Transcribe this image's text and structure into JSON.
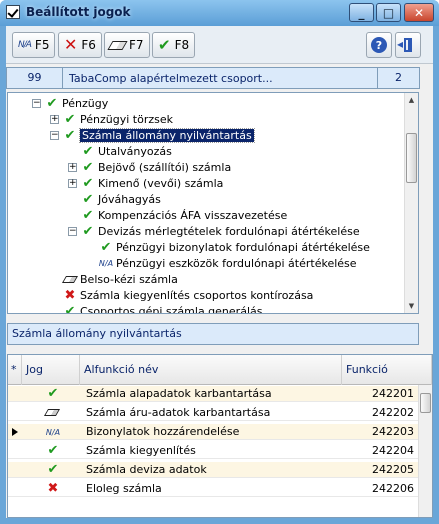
{
  "window": {
    "title": "Beállított jogok"
  },
  "toolbar": {
    "f5_label": "F5",
    "f6_label": "F6",
    "f7_label": "F7",
    "f8_label": "F8",
    "na_glyph": "N/A",
    "help_glyph": "?"
  },
  "group": {
    "id": "99",
    "name": "TabaComp alapértelmezett csoport...",
    "count": "2"
  },
  "tree": {
    "items": [
      {
        "label": "Pénzügy",
        "icon": "check",
        "expander": "minus"
      },
      {
        "label": "Pénzügyi törzsek",
        "icon": "check",
        "expander": "plus"
      },
      {
        "label": "Számla állomány nyilvántartás",
        "icon": "check",
        "expander": "minus",
        "selected": true
      },
      {
        "label": "Utalványozás",
        "icon": "check"
      },
      {
        "label": "Bejövő (szállítói) számla",
        "icon": "check",
        "expander": "plus"
      },
      {
        "label": "Kimenő (vevői) számla",
        "icon": "check",
        "expander": "plus"
      },
      {
        "label": "Jóváhagyás",
        "icon": "check"
      },
      {
        "label": "Kompenzációs ÁFA visszavezetése",
        "icon": "check"
      },
      {
        "label": "Devizás mérlegtételek fordulónapi átértékelése",
        "icon": "check",
        "expander": "minus"
      },
      {
        "label": "Pénzügyi bizonylatok fordulónapi átértékelése",
        "icon": "check"
      },
      {
        "label": "Pénzügyi eszközök fordulónapi átértékelése",
        "icon": "na"
      },
      {
        "label": "Belso-kézi számla",
        "icon": "eraser"
      },
      {
        "label": "Számla kiegyenlítés csoportos kontírozása",
        "icon": "x"
      },
      {
        "label": "Csoportos gépi számla generálás",
        "icon": "check"
      }
    ]
  },
  "selected_node": {
    "label": "Számla állomány nyilvántartás"
  },
  "grid": {
    "headers": {
      "star": "*",
      "jog": "Jog",
      "name": "Alfunkció név",
      "code": "Funkció"
    },
    "rows": [
      {
        "icon": "check",
        "name": "Számla alapadatok karbantartása",
        "code": "242201"
      },
      {
        "icon": "eraser",
        "name": "Számla áru-adatok karbantartása",
        "code": "242202"
      },
      {
        "icon": "na",
        "name": "Bizonylatok hozzárendelése",
        "code": "242203",
        "current": true
      },
      {
        "icon": "check",
        "name": "Számla kiegyenlítés",
        "code": "242204"
      },
      {
        "icon": "check",
        "name": "Számla deviza adatok",
        "code": "242205"
      },
      {
        "icon": "x",
        "name": "Eloleg számla",
        "code": "242206"
      }
    ]
  },
  "colors": {
    "check": "#1f9a1f",
    "x": "#d01818",
    "selection": "#0a246a"
  }
}
